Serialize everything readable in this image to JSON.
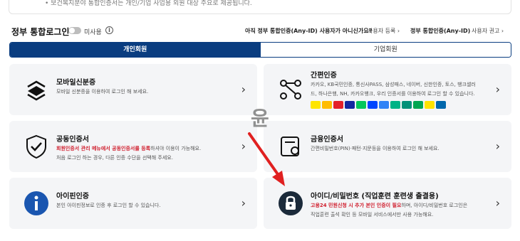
{
  "notice": {
    "text": "• 보건복지분야 통합인증서는 개인/기업 사업용 외원 대상 주요로 제공됩니다."
  },
  "topbar": {
    "title": "정부 통합로그인",
    "toggle_label": "미사용",
    "question": "아직 정부 통합인증(Any-ID) 사용자가 아니신가요?",
    "register": "사용자 등록 ›",
    "gov_anyid": "정부 통합인증(Any-ID)",
    "guide": "사용자 권고 ›"
  },
  "tabs": [
    {
      "label": "개인회원",
      "active": true
    },
    {
      "label": "기업회원",
      "active": false
    }
  ],
  "cards": {
    "mobile": {
      "title": "모바일신분증",
      "desc": "모바일 신분증을 이용하여 로그인 해 보세요."
    },
    "simple": {
      "title": "간편인증",
      "desc1": "카카오, KB국민인증, 통신사PASS, 삼성패스, 네이버, 신한인증, 토스, 뱅크샐러",
      "desc2": "드, 하나은행, NH, 카카오뱅크, 우리 인증서를 이용하여 로그인 할 수 있습니다."
    },
    "joint": {
      "title": "공동인증서",
      "desc1_red": "회원인증서 관리 메뉴에서 공동인증서를 등록",
      "desc1_rest": "하셔야 이용이 가능해요.",
      "desc2": "처음 로그인 하는 경우, 다른 인증 수단을 선택해 주세요."
    },
    "finance": {
      "title": "금융인증서",
      "desc": "간편비밀번호(PIN)·패턴·지문등을 이용하여 로그인 해 보세요."
    },
    "ipin": {
      "title": "아이핀인증",
      "desc": "본인 아이핀정보로 인증 후 로그인 할 수 있습니다."
    },
    "idpw": {
      "title": "아이디/비밀번호 (직업훈련 훈련생 출결용)",
      "desc1_red": "고용24 민원신청 시 추가 본인 인증이 필요",
      "desc1_rest": "하며, 아이디/비밀번호 로그인은",
      "desc2": "직업훈련 출석 확인 등 모바일 서비스에서만 사용 가능해요."
    }
  },
  "watermark": "윤",
  "colors": {
    "primary": "#0a3d80",
    "accent_red": "#d0202f",
    "arrow": "#e02020",
    "card_bg": "#f4f5f7"
  }
}
